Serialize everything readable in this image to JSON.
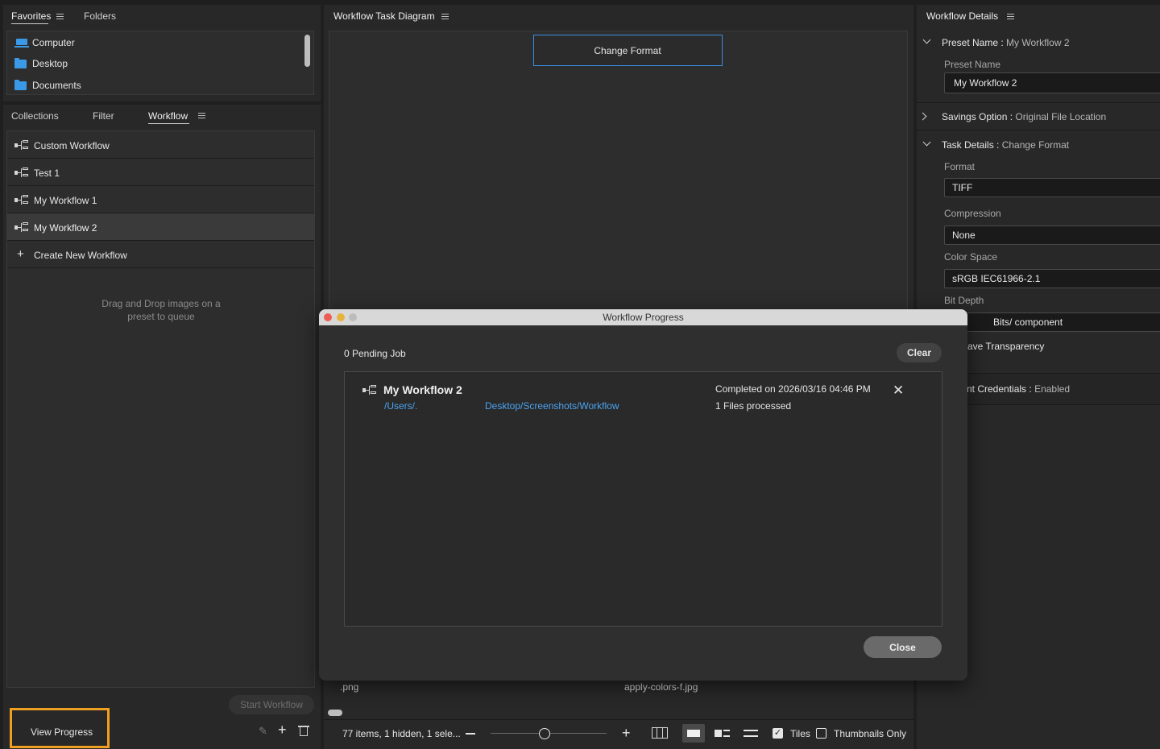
{
  "favorites_panel": {
    "tabs": [
      "Favorites",
      "Folders"
    ],
    "items": [
      {
        "label": "Computer",
        "icon": "computer-icon"
      },
      {
        "label": "Desktop",
        "icon": "folder-icon"
      },
      {
        "label": "Documents",
        "icon": "folder-icon"
      }
    ]
  },
  "workflow_panel": {
    "tabs": [
      "Collections",
      "Filter",
      "Workflow"
    ],
    "active_tab": "Workflow",
    "items": [
      {
        "label": "Custom Workflow"
      },
      {
        "label": "Test 1"
      },
      {
        "label": "My Workflow 1"
      },
      {
        "label": "My Workflow 2",
        "selected": true
      }
    ],
    "create_label": "Create New Workflow",
    "drop_hint_line1": "Drag and Drop images on a",
    "drop_hint_line2": "preset to queue",
    "start_button": "Start Workflow",
    "view_progress_button": "View Progress"
  },
  "diagram": {
    "title": "Workflow Task Diagram",
    "node_label": "Change Format"
  },
  "content_bar": {
    "file1": ".png",
    "file2": "apply-colors-f.jpg",
    "status": "77 items, 1 hidden, 1 sele...",
    "tiles_label": "Tiles",
    "thumbnails_label": "Thumbnails Only"
  },
  "details": {
    "title": "Workflow Details",
    "preset_name_key": "Preset Name",
    "preset_name_value": "My Workflow 2",
    "preset_name_field_label": "Preset Name",
    "preset_name_field": "My Workflow 2",
    "savings_key": "Savings Option",
    "savings_value": "Original File Location",
    "task_key": "Task Details",
    "task_value": "Change Format",
    "format_label": "Format",
    "format_value": "TIFF",
    "compression_label": "Compression",
    "compression_value": "None",
    "colorspace_label": "Color Space",
    "colorspace_value": "sRGB IEC61966-2.1",
    "bitdepth_label": "Bit Depth",
    "bitdepth_value": "Bits/ component",
    "transparency_label": "ave Transparency",
    "credentials_key": "nt Credentials",
    "credentials_value": "Enabled"
  },
  "dialog": {
    "title": "Workflow Progress",
    "pending": "0 Pending Job",
    "clear_button": "Clear",
    "job": {
      "name": "My Workflow 2",
      "path_part1": "/Users/.",
      "path_part2": "Desktop/Screenshots/Workflow",
      "completed": "Completed on 2026/03/16 04:46 PM",
      "files": "1 Files processed"
    },
    "close_button": "Close"
  },
  "colors": {
    "accent_blue": "#3b9ae8",
    "highlight_orange": "#f0a020",
    "link_blue": "#4aa3f0"
  }
}
